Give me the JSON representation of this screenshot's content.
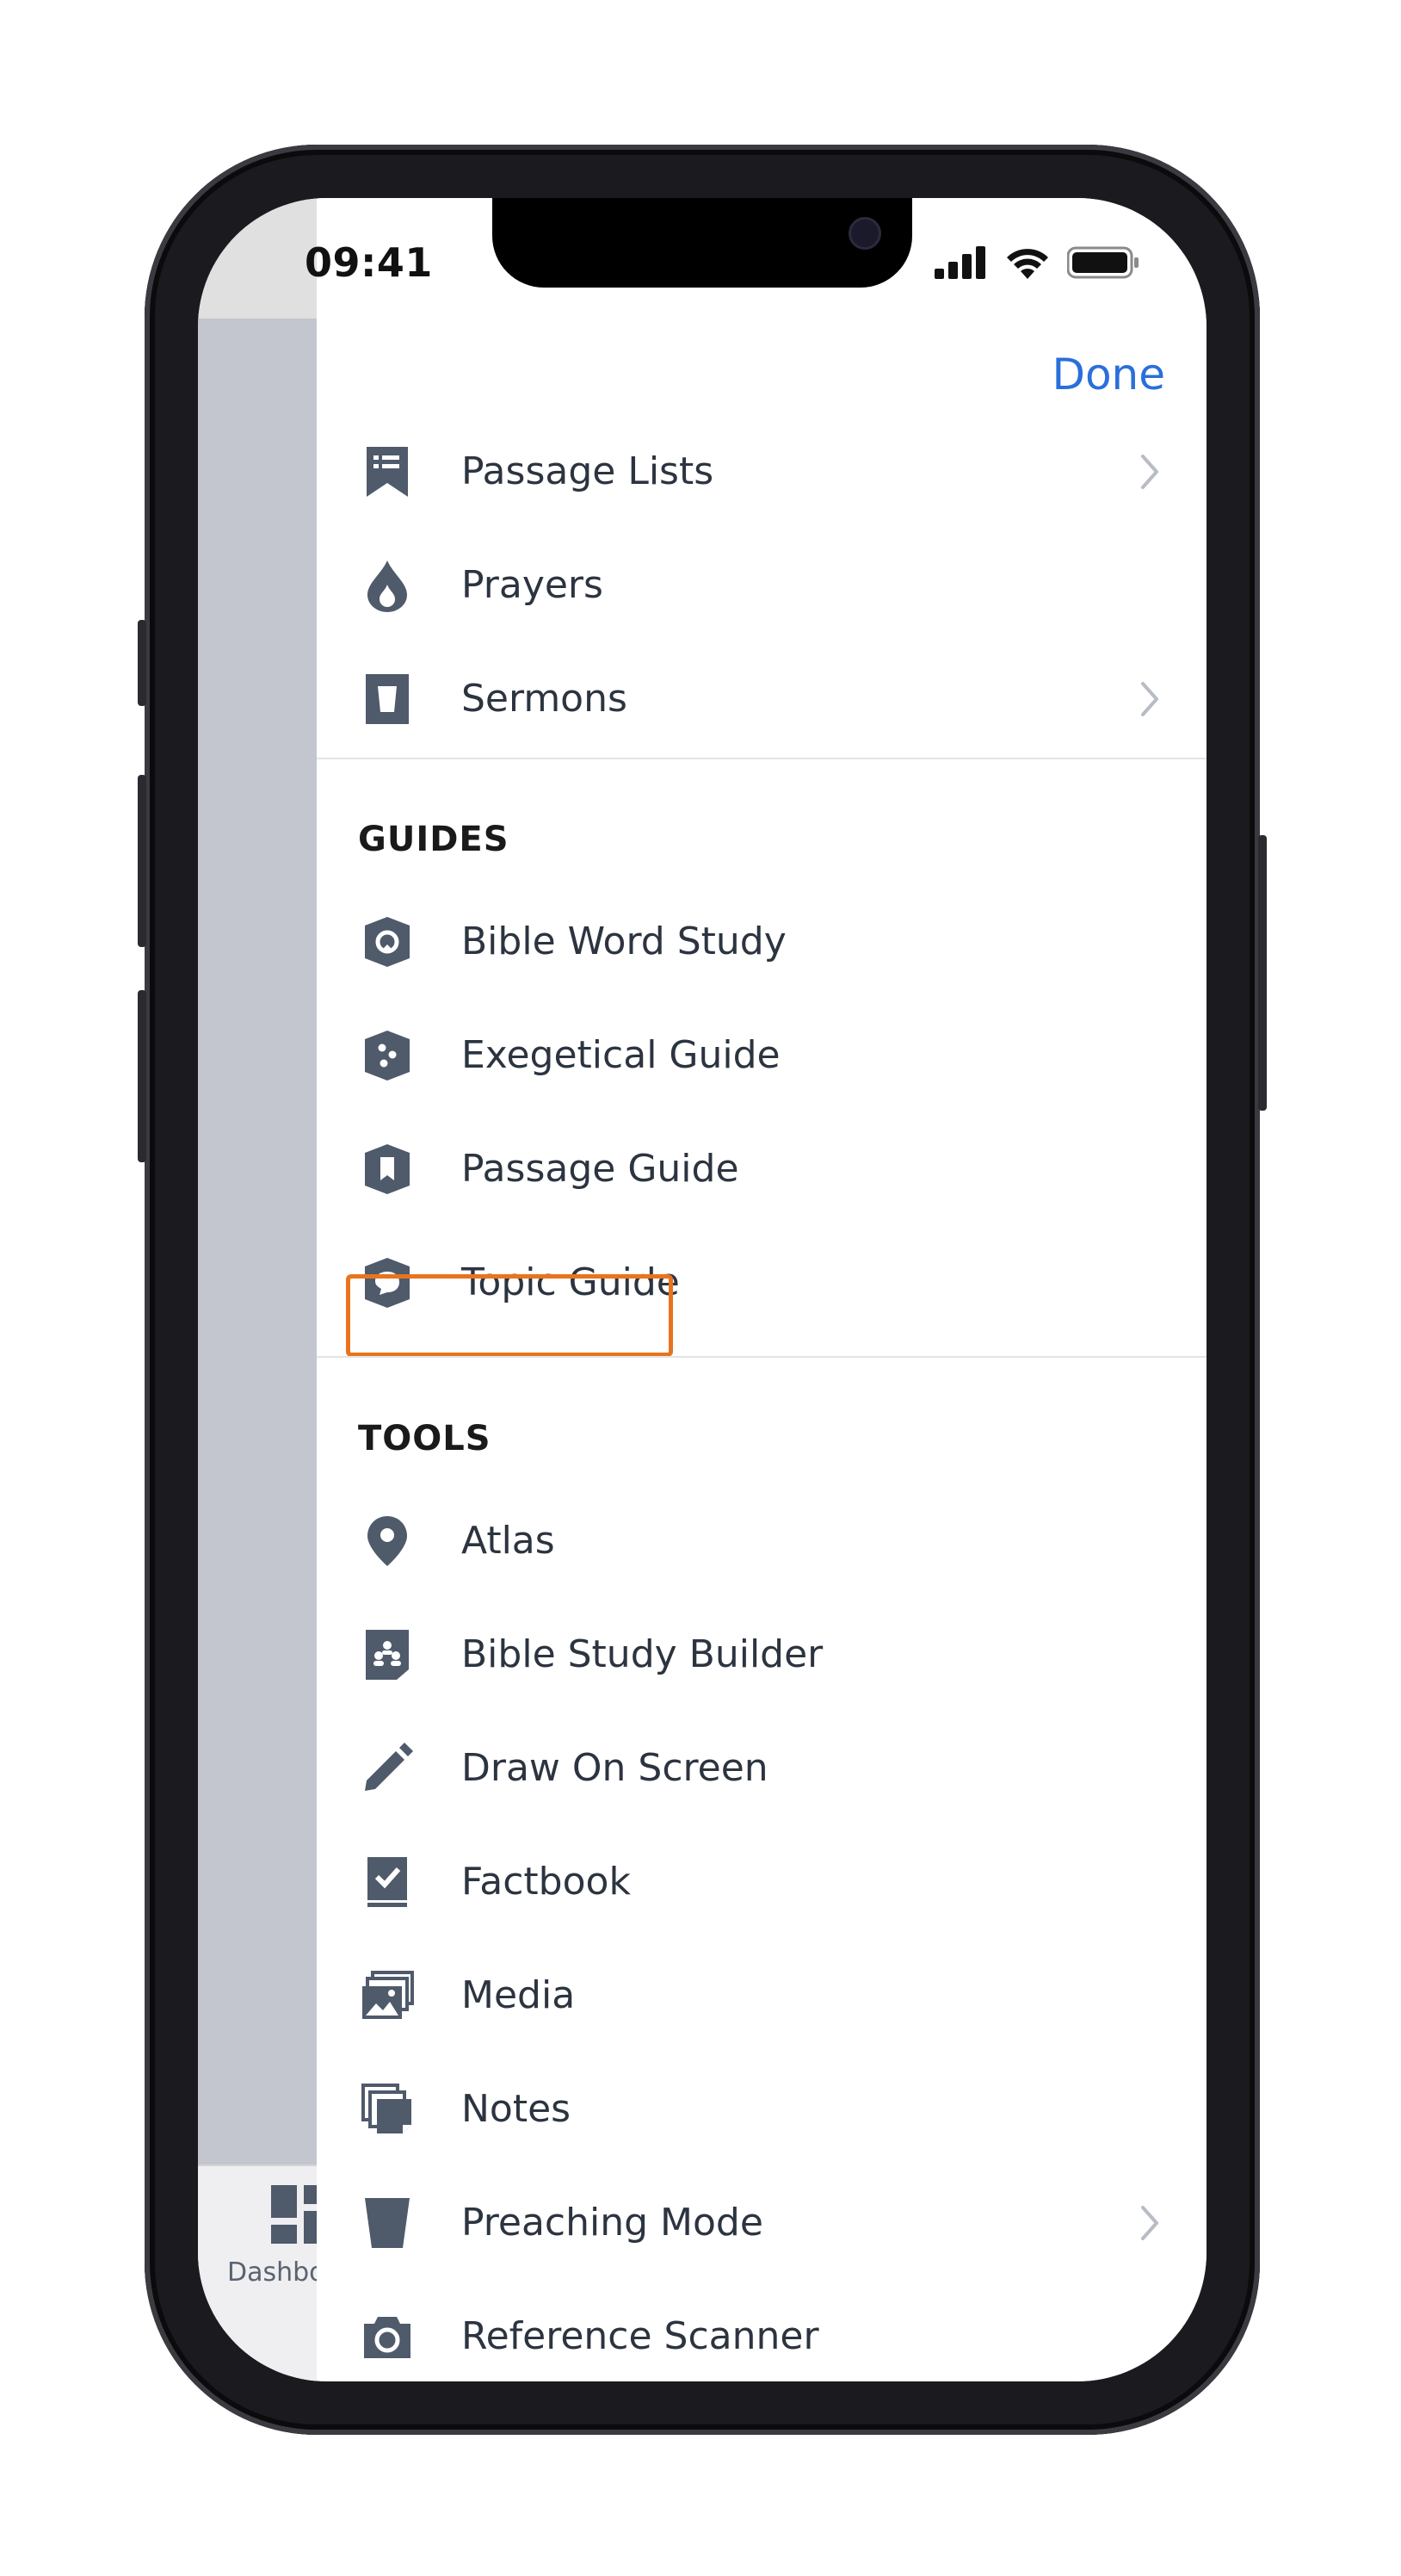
{
  "status_bar": {
    "time": "09:41"
  },
  "header": {
    "done_label": "Done"
  },
  "bottom_tab": {
    "label": "Dashbo"
  },
  "top_items": [
    {
      "label": "Passage Lists",
      "icon": "passage-lists-icon",
      "has_chevron": true
    },
    {
      "label": "Prayers",
      "icon": "prayers-icon",
      "has_chevron": false
    },
    {
      "label": "Sermons",
      "icon": "sermons-icon",
      "has_chevron": true
    }
  ],
  "guides": {
    "title": "GUIDES",
    "items": [
      {
        "label": "Bible Word Study",
        "icon": "bible-word-study-icon"
      },
      {
        "label": "Exegetical Guide",
        "icon": "exegetical-guide-icon"
      },
      {
        "label": "Passage Guide",
        "icon": "passage-guide-icon"
      },
      {
        "label": "Topic Guide",
        "icon": "topic-guide-icon",
        "highlighted": true
      }
    ]
  },
  "tools": {
    "title": "TOOLS",
    "items": [
      {
        "label": "Atlas",
        "icon": "atlas-icon"
      },
      {
        "label": "Bible Study Builder",
        "icon": "bible-study-builder-icon"
      },
      {
        "label": "Draw On Screen",
        "icon": "draw-on-screen-icon"
      },
      {
        "label": "Factbook",
        "icon": "factbook-icon"
      },
      {
        "label": "Media",
        "icon": "media-icon"
      },
      {
        "label": "Notes",
        "icon": "notes-icon"
      },
      {
        "label": "Preaching Mode",
        "icon": "preaching-mode-icon",
        "has_chevron": true
      },
      {
        "label": "Reference Scanner",
        "icon": "reference-scanner-icon"
      }
    ]
  },
  "colors": {
    "accent": "#2a6fdb",
    "icon": "#4f5a6b",
    "highlight": "#e8741e",
    "text": "#2c3440"
  }
}
